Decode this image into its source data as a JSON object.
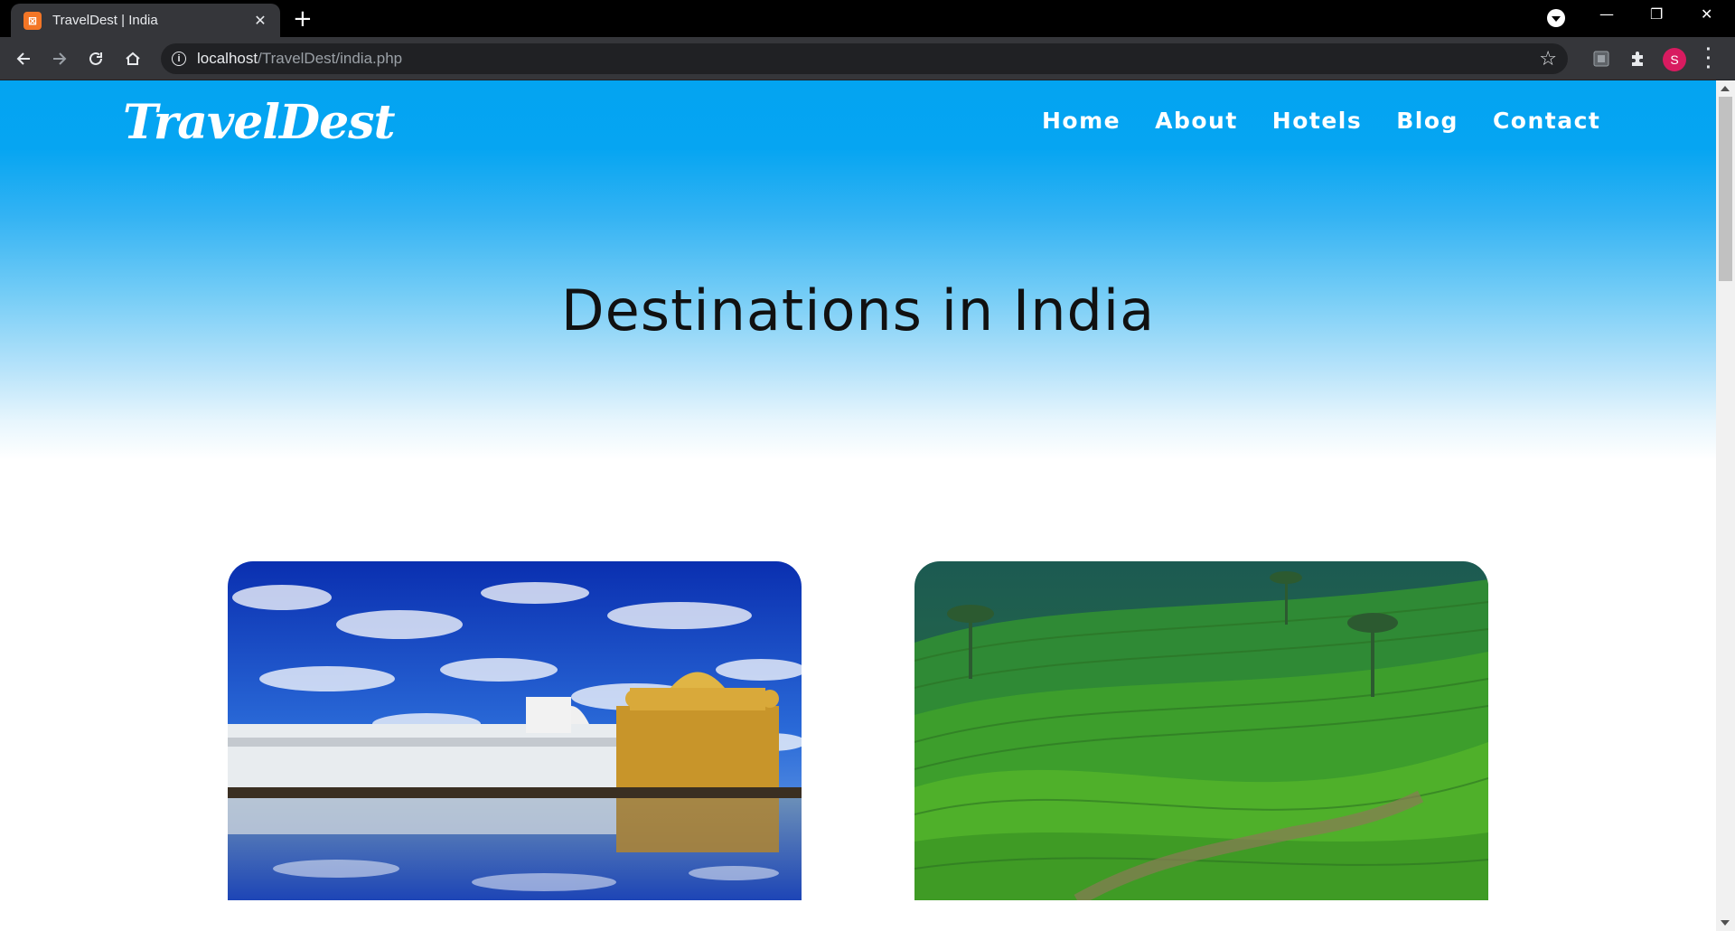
{
  "browser": {
    "tab_title": "TravelDest | India",
    "tab_favicon": "xampp-icon",
    "url_host": "localhost",
    "url_path": "/TravelDest/india.php",
    "profile_initial": "S",
    "profile_color": "#d81b60"
  },
  "site": {
    "logo": "TravelDest",
    "nav": [
      "Home",
      "About",
      "Hotels",
      "Blog",
      "Contact"
    ],
    "hero_title": "Destinations in India",
    "accent_color": "#03a4f1"
  },
  "cards": [
    {
      "image": "golden-temple-photo"
    },
    {
      "image": "tea-plantation-photo"
    }
  ]
}
